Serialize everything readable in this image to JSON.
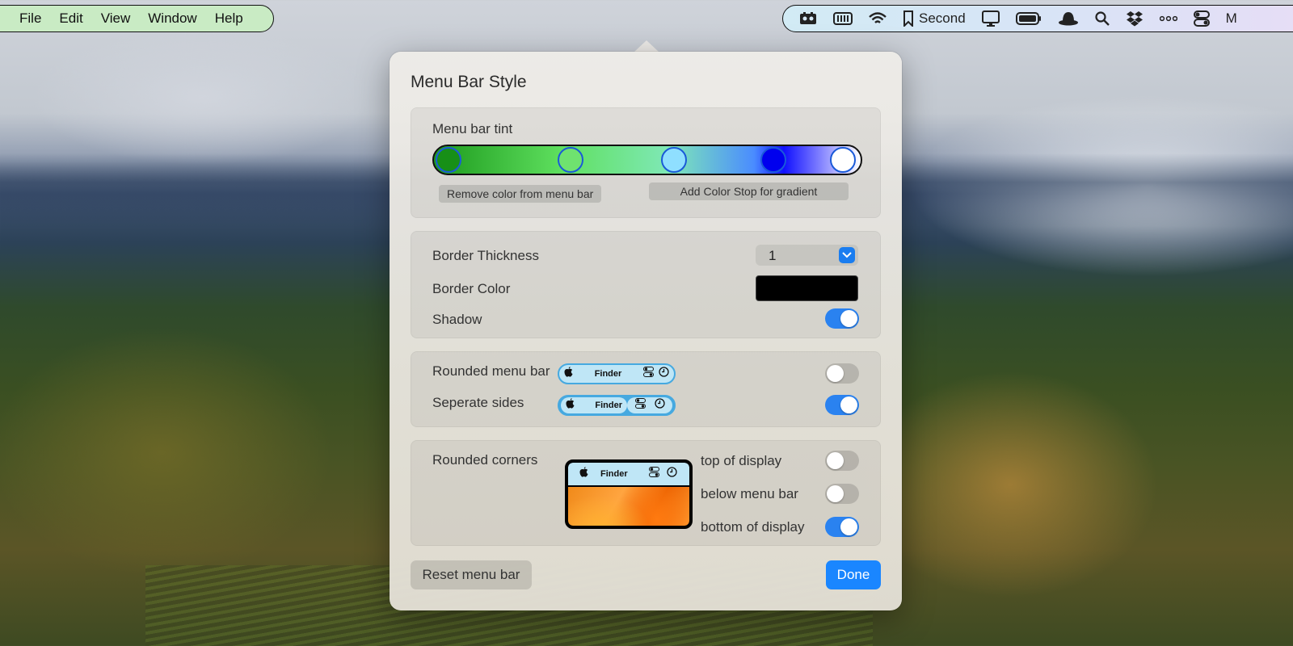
{
  "menubar": {
    "menus": [
      "File",
      "Edit",
      "View",
      "Window",
      "Help"
    ],
    "tray_icons": [
      "menubar-app-icon",
      "battery-stripes-icon",
      "wifi-icon",
      "bookmark-icon",
      "display-icon",
      "battery-icon",
      "hat-icon",
      "search-icon",
      "dropbox-icon",
      "more-dots-icon",
      "control-center-icon"
    ],
    "second_label": "Second",
    "truncated_label": "M"
  },
  "popover": {
    "title": "Menu Bar Style",
    "tint": {
      "label": "Menu bar tint",
      "color_stops": [
        "#178f17",
        "#6fe26f",
        "#8fdfff",
        "#0000ee",
        "#ffffff"
      ],
      "remove_label": "Remove color from menu bar",
      "add_label": "Add Color Stop for gradient"
    },
    "border": {
      "thickness_label": "Border Thickness",
      "thickness_value": "1",
      "color_label": "Border Color",
      "color_value": "#000000",
      "shadow_label": "Shadow",
      "shadow_on": true
    },
    "shape": {
      "rounded_label": "Rounded menu bar",
      "rounded_on": false,
      "separate_label": "Seperate sides",
      "separate_on": true,
      "preview_app": "Finder"
    },
    "corners": {
      "label": "Rounded corners",
      "preview_app": "Finder",
      "top_label": "top of display",
      "top_on": false,
      "below_label": "below menu bar",
      "below_on": false,
      "bottom_label": "bottom of display",
      "bottom_on": true
    },
    "reset_label": "Reset menu bar",
    "done_label": "Done"
  },
  "colors": {
    "accent": "#1a86ff",
    "left_menubar_bg": "#c9ebc4",
    "preview_bar_bg": "#bfe6f6"
  }
}
